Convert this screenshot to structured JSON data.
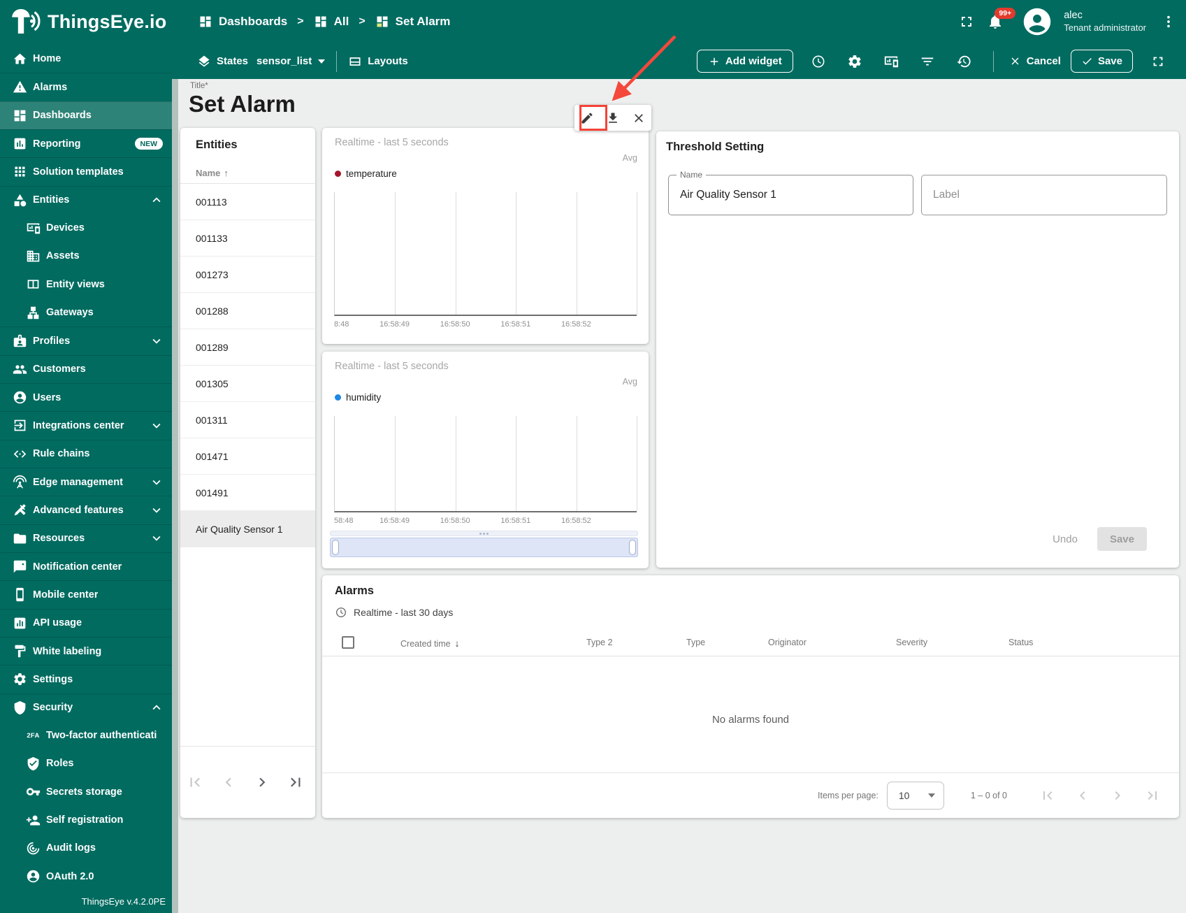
{
  "header": {
    "brand": "ThingsEye.io",
    "breadcrumbs": [
      {
        "label": "Dashboards",
        "icon": "dashboards"
      },
      {
        "label": "All",
        "icon": "dashboards"
      },
      {
        "label": "Set Alarm",
        "icon": "dashboards-colored"
      }
    ],
    "notification_count": "99+",
    "user": {
      "name": "alec",
      "role": "Tenant administrator"
    }
  },
  "toolbar": {
    "states_label": "States",
    "states_value": "sensor_list",
    "layouts_label": "Layouts",
    "add_widget_label": "Add widget",
    "cancel_label": "Cancel",
    "save_label": "Save"
  },
  "sidebar": {
    "version": "ThingsEye v.4.2.0PE",
    "items": [
      {
        "label": "Home",
        "icon": "home"
      },
      {
        "label": "Alarms",
        "icon": "alarm-warning",
        "divider": true
      },
      {
        "label": "Dashboards",
        "icon": "dashboards",
        "active": true,
        "divider": true
      },
      {
        "label": "Reporting",
        "icon": "reporting",
        "badge": "NEW",
        "divider": true
      },
      {
        "label": "Solution templates",
        "icon": "solution-templates",
        "divider": true
      },
      {
        "label": "Entities",
        "icon": "entities",
        "chevron": "up",
        "divider": true
      },
      {
        "label": "Devices",
        "icon": "devices",
        "sub": true
      },
      {
        "label": "Assets",
        "icon": "assets",
        "sub": true
      },
      {
        "label": "Entity views",
        "icon": "entity-views",
        "sub": true
      },
      {
        "label": "Gateways",
        "icon": "gateways",
        "sub": true
      },
      {
        "label": "Profiles",
        "icon": "profiles",
        "chevron": "down",
        "divider": true
      },
      {
        "label": "Customers",
        "icon": "customers",
        "divider": true
      },
      {
        "label": "Users",
        "icon": "users",
        "divider": true
      },
      {
        "label": "Integrations center",
        "icon": "integrations",
        "chevron": "down",
        "divider": true
      },
      {
        "label": "Rule chains",
        "icon": "rule-chains",
        "divider": true
      },
      {
        "label": "Edge management",
        "icon": "edge",
        "chevron": "down",
        "divider": true
      },
      {
        "label": "Advanced features",
        "icon": "advanced",
        "chevron": "down",
        "divider": true
      },
      {
        "label": "Resources",
        "icon": "resources",
        "chevron": "down",
        "divider": true
      },
      {
        "label": "Notification center",
        "icon": "notification",
        "divider": true
      },
      {
        "label": "Mobile center",
        "icon": "mobile",
        "divider": true
      },
      {
        "label": "API usage",
        "icon": "api-usage",
        "divider": true
      },
      {
        "label": "White labeling",
        "icon": "white-labeling",
        "divider": true
      },
      {
        "label": "Settings",
        "icon": "settings",
        "divider": true
      },
      {
        "label": "Security",
        "icon": "security",
        "chevron": "up",
        "divider": true
      },
      {
        "label": "Two-factor authenticati…",
        "icon": "2fa",
        "sub": true
      },
      {
        "label": "Roles",
        "icon": "roles",
        "sub": true
      },
      {
        "label": "Secrets storage",
        "icon": "secrets",
        "sub": true
      },
      {
        "label": "Self registration",
        "icon": "self-registration",
        "sub": true
      },
      {
        "label": "Audit logs",
        "icon": "audit-logs",
        "sub": true
      },
      {
        "label": "OAuth 2.0",
        "icon": "oauth",
        "sub": true
      }
    ]
  },
  "page": {
    "title_label": "Title*",
    "title": "Set Alarm"
  },
  "entities": {
    "title": "Entities",
    "name_column": "Name",
    "rows": [
      "001113",
      "001133",
      "001273",
      "001288",
      "001289",
      "001305",
      "001311",
      "001471",
      "001491",
      "Air Quality Sensor 1"
    ],
    "selected_row": "Air Quality Sensor 1"
  },
  "widgets": {
    "charts": [
      {
        "timewindow": "Realtime - last 5 seconds",
        "aggregation": "Avg",
        "series_name": "temperature",
        "series_color": "#a3162b",
        "x_ticks": [
          "8:48",
          "16:58:49",
          "16:58:50",
          "16:58:51",
          "16:58:52"
        ]
      },
      {
        "timewindow": "Realtime - last 5 seconds",
        "aggregation": "Avg",
        "series_name": "humidity",
        "series_color": "#1e88e5",
        "x_ticks": [
          "58:48",
          "16:58:49",
          "16:58:50",
          "16:58:51",
          "16:58:52"
        ]
      }
    ]
  },
  "threshold": {
    "title": "Threshold Setting",
    "name_label": "Name",
    "name_value": "Air Quality Sensor 1",
    "label_placeholder": "Label",
    "undo_label": "Undo",
    "save_label": "Save"
  },
  "alarms": {
    "title": "Alarms",
    "timewindow": "Realtime - last 30 days",
    "columns": [
      "Created time",
      "Type 2",
      "Type",
      "Originator",
      "Severity",
      "Status"
    ],
    "empty_message": "No alarms found",
    "pagination": {
      "items_per_page_label": "Items per page:",
      "items_per_page": "10",
      "range": "1 – 0 of 0"
    }
  },
  "annotation": {
    "color": "#f44336",
    "note": "red arrow pointing at widget edit (pencil) button"
  }
}
